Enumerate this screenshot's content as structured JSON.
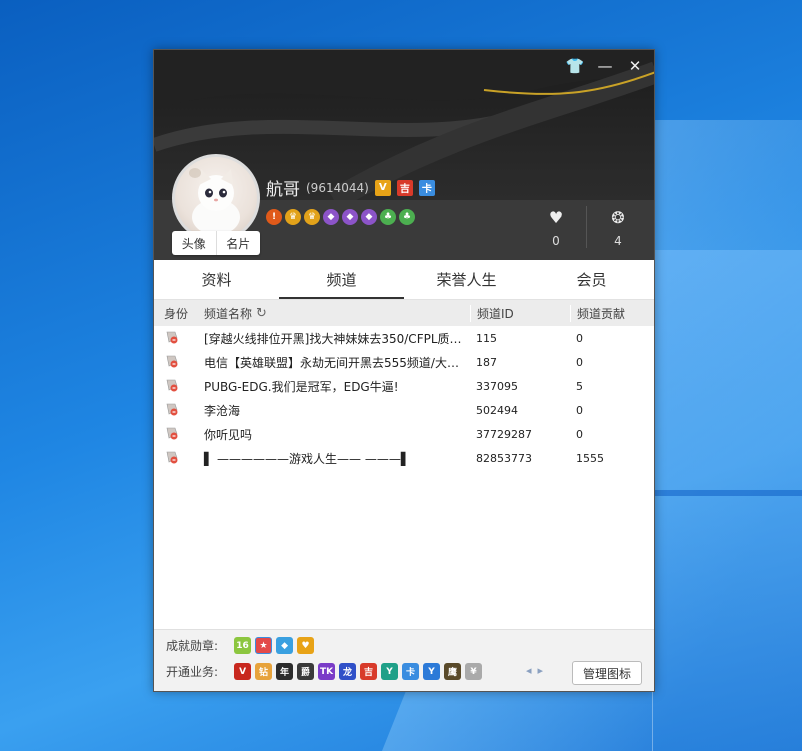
{
  "profile": {
    "nickname": "航哥",
    "uid": "(9614044)",
    "avatar_btn": "头像",
    "card_btn": "名片",
    "likes": "0",
    "awards": "4"
  },
  "tabs": [
    {
      "label": "资料"
    },
    {
      "label": "频道"
    },
    {
      "label": "荣誉人生"
    },
    {
      "label": "会员"
    }
  ],
  "table": {
    "headers": {
      "role": "身份",
      "name": "频道名称",
      "id": "频道ID",
      "contrib": "频道贡献"
    },
    "rows": [
      {
        "name": "[穿越火线排位开黑]找大神妹妹去350/CFPL质…",
        "id": "115",
        "contrib": "0"
      },
      {
        "name": "电信【英雄联盟】永劫无间开黑去555频道/大…",
        "id": "187",
        "contrib": "0"
      },
      {
        "name": "PUBG-EDG.我们是冠军，EDG牛逼!",
        "id": "337095",
        "contrib": "5"
      },
      {
        "name": "李沧海",
        "id": "502494",
        "contrib": "0"
      },
      {
        "name": "你听见吗",
        "id": "37729287",
        "contrib": "0"
      },
      {
        "name": "▌ ——————游戏人生—— ———▌",
        "id": "82853773",
        "contrib": "1555"
      }
    ]
  },
  "footer": {
    "achievements_label": "成就勋章:",
    "services_label": "开通业务:",
    "manage_btn": "管理图标"
  },
  "header_badges": [
    {
      "text": "V",
      "color": "#e8a317"
    },
    {
      "text": "吉",
      "color": "#d83a2a"
    },
    {
      "text": "卡",
      "color": "#3a8de0"
    }
  ],
  "service_badges": [
    {
      "text": "V",
      "color": "#c8281e"
    },
    {
      "text": "钻",
      "color": "#e7a33c"
    },
    {
      "text": "年",
      "color": "#2c2c2c"
    },
    {
      "text": "爵",
      "color": "#3a3a3a"
    },
    {
      "text": "TK",
      "color": "#7a3cc8"
    },
    {
      "text": "龙",
      "color": "#3050c8"
    },
    {
      "text": "吉",
      "color": "#d83a2a"
    },
    {
      "text": "Y",
      "color": "#1fa088"
    },
    {
      "text": "卡",
      "color": "#3a8de0"
    },
    {
      "text": "Y",
      "color": "#2c7ad8"
    },
    {
      "text": "鹰",
      "color": "#5a4a2a"
    },
    {
      "text": "¥",
      "color": "#aaaaaa"
    }
  ]
}
